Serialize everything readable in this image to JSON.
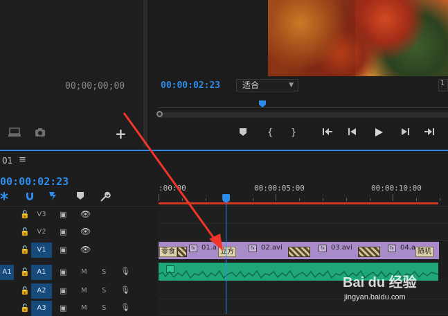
{
  "source_monitor": {
    "timecode": "00;00;00;00",
    "icons": [
      "export-frame-icon",
      "camera-icon",
      "add-icon"
    ],
    "add_label": "+"
  },
  "program_monitor": {
    "timecode": "00:00:02:23",
    "fit": "适合",
    "right_chip": "1",
    "transport": [
      "marker-icon",
      "in-point-icon",
      "out-point-icon",
      "go-to-in-icon",
      "step-back-icon",
      "play-icon",
      "step-forward-icon",
      "go-to-out-icon"
    ]
  },
  "timeline": {
    "sequence": "01",
    "menu_glyph": "≡",
    "timecode": "00:00:02:23",
    "ruler": [
      ":00:00",
      "00:00:05:00",
      "00:00:10:00"
    ],
    "tracks": {
      "video": [
        {
          "name": "V3",
          "active": false
        },
        {
          "name": "V2",
          "active": false
        },
        {
          "name": "V1",
          "active": true
        }
      ],
      "audio": [
        {
          "name": "A1",
          "source": "A1"
        },
        {
          "name": "A2",
          "source": ""
        },
        {
          "name": "A3",
          "source": ""
        }
      ]
    },
    "mute_label": "M",
    "solo_label": "S",
    "clips": {
      "v1": [
        "01.a",
        "02.avi",
        "03.avi",
        "04.a"
      ],
      "tags": [
        "零食",
        "立方",
        "随机"
      ],
      "fx": "fx"
    },
    "colors": {
      "playhead": "#2d8ceb",
      "work_area": "#d23a24",
      "video_clip": "#a98bc9",
      "audio_clip": "#1fa77a"
    }
  },
  "watermark": {
    "brand": "Bai du 经验",
    "url": "jingyan.baidu.com"
  }
}
